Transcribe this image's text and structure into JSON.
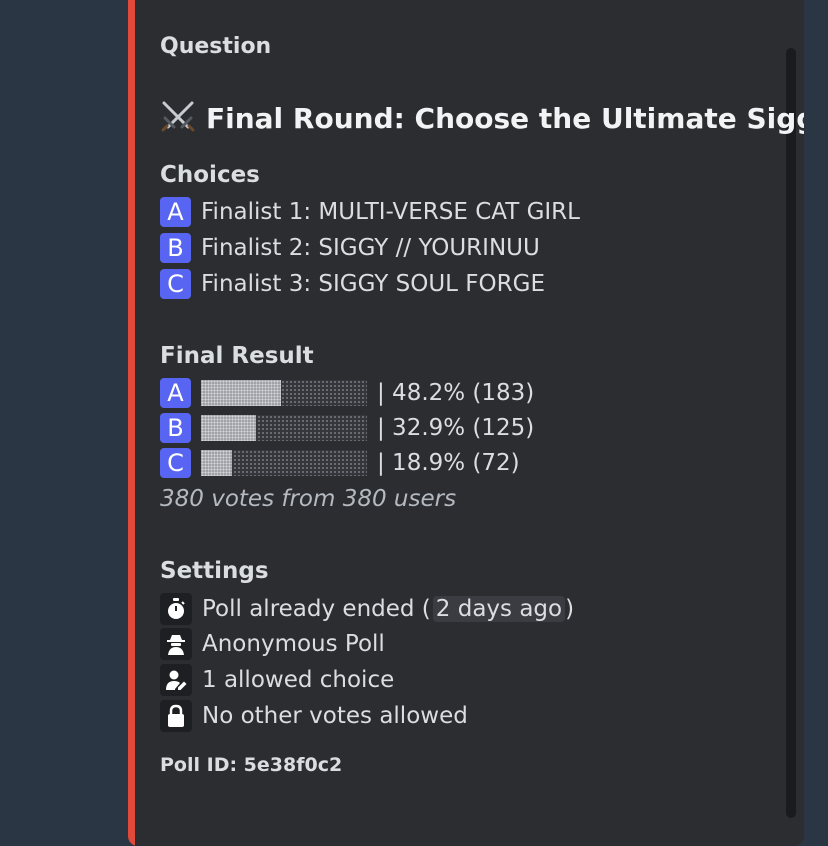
{
  "poll": {
    "question_label": "Question",
    "title": "Final Round: Choose the Ultimate Siggy",
    "choices_label": "Choices",
    "choices": [
      {
        "key": "A",
        "label": "Finalist 1: MULTI-VERSE CAT GIRL"
      },
      {
        "key": "B",
        "label": "Finalist 2: SIGGY // YOURINUU"
      },
      {
        "key": "C",
        "label": "Finalist 3: SIGGY SOUL FORGE"
      }
    ],
    "result_label": "Final Result",
    "results": [
      {
        "key": "A",
        "text": "| 48.2% (183)",
        "fraction": 0.482
      },
      {
        "key": "B",
        "text": "| 32.9% (125)",
        "fraction": 0.329
      },
      {
        "key": "C",
        "text": "| 18.9% (72)",
        "fraction": 0.189
      }
    ],
    "votes_summary": "380 votes from 380 users",
    "settings_label": "Settings",
    "settings": {
      "ended_prefix": "Poll already ended (",
      "ended_time": "2 days ago",
      "ended_suffix": ")",
      "anonymous": "Anonymous Poll",
      "allowed": "1 allowed choice",
      "no_other": "No other votes allowed"
    },
    "poll_id": "Poll ID: 5e38f0c2"
  },
  "colors": {
    "accent_bar": "#e04a3a",
    "key_badge": "#5865f2",
    "embed_bg": "#2b2d31"
  }
}
